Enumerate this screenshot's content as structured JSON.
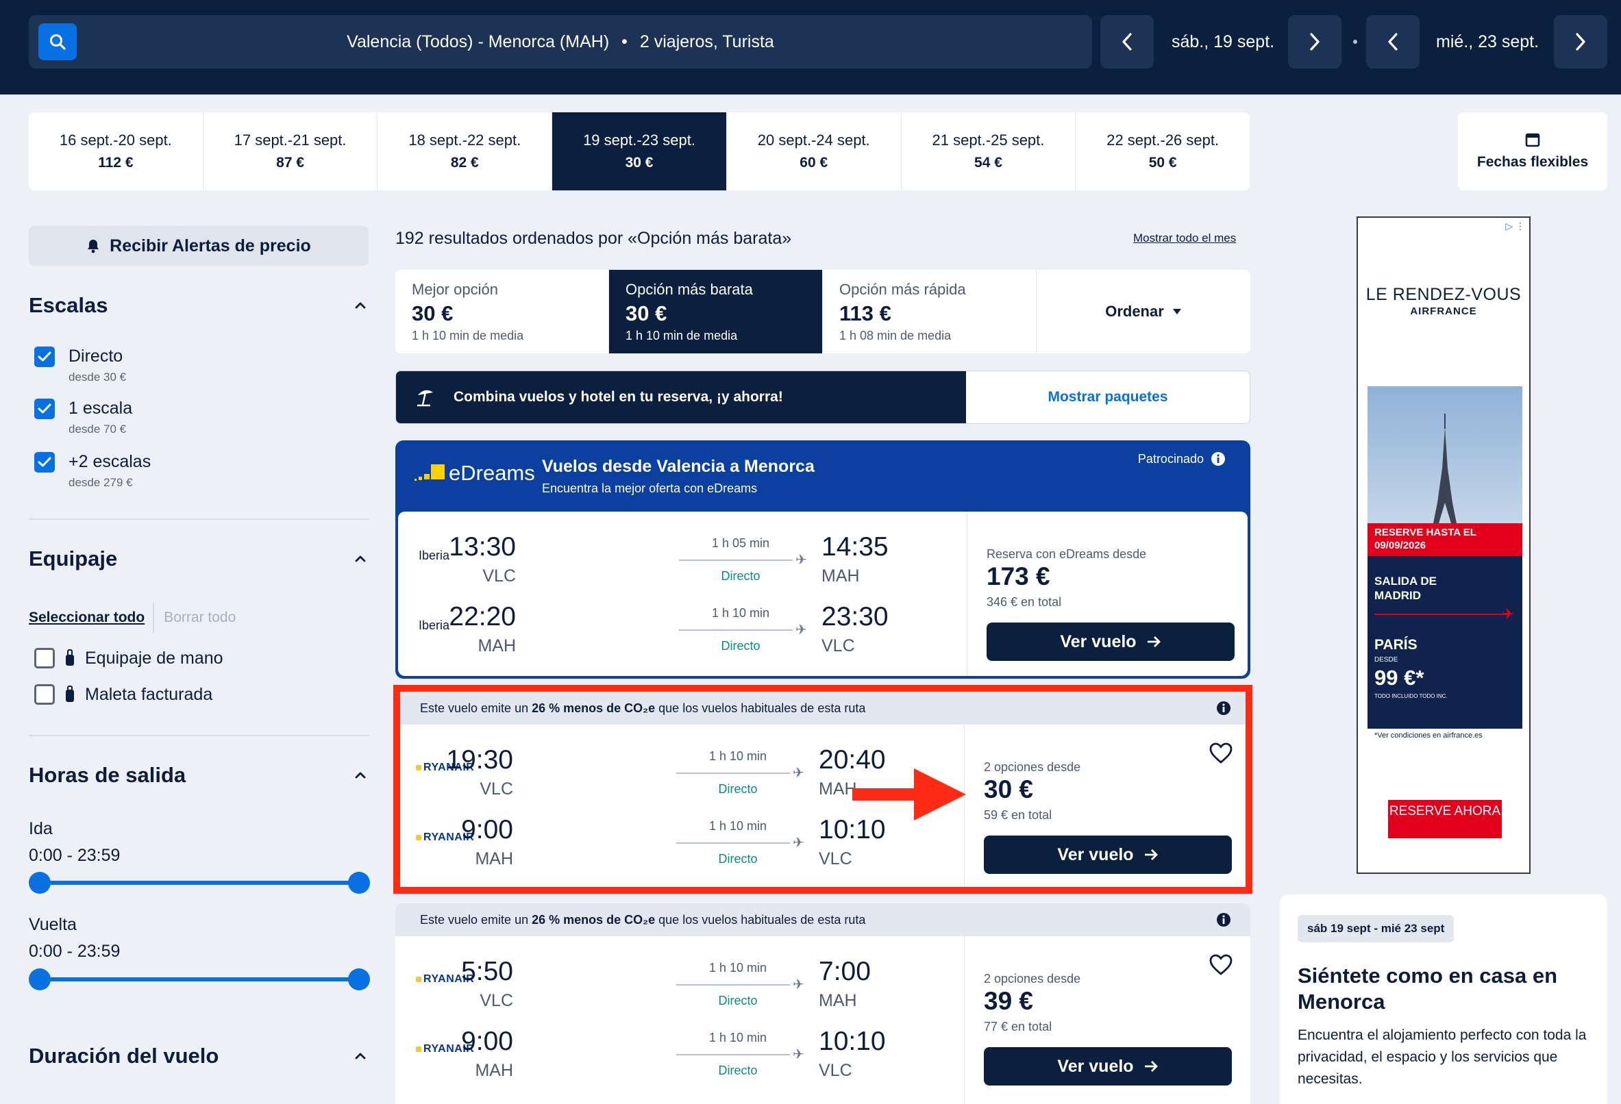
{
  "header": {
    "route": "Valencia (Todos) - Menorca (MAH)",
    "separator": "•",
    "travellers": "2 viajeros, Turista",
    "depart_date": "sáb., 19 sept.",
    "return_date": "mié., 23 sept."
  },
  "date_strip": [
    {
      "dates": "16 sept.-20 sept.",
      "price": "112 €"
    },
    {
      "dates": "17 sept.-21 sept.",
      "price": "87 €"
    },
    {
      "dates": "18 sept.-22 sept.",
      "price": "82 €"
    },
    {
      "dates": "19 sept.-23 sept.",
      "price": "30 €",
      "active": true
    },
    {
      "dates": "20 sept.-24 sept.",
      "price": "60 €"
    },
    {
      "dates": "21 sept.-25 sept.",
      "price": "54 €"
    },
    {
      "dates": "22 sept.-26 sept.",
      "price": "50 €"
    }
  ],
  "flex_dates": "Fechas flexibles",
  "sidebar": {
    "alert_button": "Recibir Alertas de precio",
    "stops_title": "Escalas",
    "stops": [
      {
        "label": "Directo",
        "sub": "desde 30 €",
        "checked": true
      },
      {
        "label": "1 escala",
        "sub": "desde 70 €",
        "checked": true
      },
      {
        "label": "+2 escalas",
        "sub": "desde 279 €",
        "checked": true
      }
    ],
    "baggage_title": "Equipaje",
    "select_all": "Seleccionar todo",
    "clear_all": "Borrar todo",
    "bags": [
      {
        "label": "Equipaje de mano",
        "checked": false
      },
      {
        "label": "Maleta facturada",
        "checked": false
      }
    ],
    "times_title": "Horas de salida",
    "outbound_label": "Ida",
    "outbound_range": "0:00 - 23:59",
    "return_label": "Vuelta",
    "return_range": "0:00 - 23:59",
    "duration_title": "Duración del vuelo"
  },
  "results": {
    "count_text": "192 resultados ordenados por «Opción más barata»",
    "show_month": "Mostrar todo el mes",
    "sort_tabs": [
      {
        "title": "Mejor opción",
        "price": "30 €",
        "sub": "1 h 10 min de media"
      },
      {
        "title": "Opción más barata",
        "price": "30 €",
        "sub": "1 h 10 min de media",
        "active": true
      },
      {
        "title": "Opción más rápida",
        "price": "113 €",
        "sub": "1 h 08 min de media"
      }
    ],
    "order_label": "Ordenar",
    "packages_text": "Combina vuelos y hotel en tu reserva, ¡y ahorra!",
    "packages_link": "Mostrar paquetes"
  },
  "sponsored": {
    "brand": "eDreams",
    "title": "Vuelos desde Valencia a Menorca",
    "subtitle": "Encuentra la mejor oferta con eDreams",
    "tag": "Patrocinado",
    "legs": [
      {
        "airline": "Iberia",
        "dep": "13:30",
        "dep_code": "VLC",
        "duration": "1 h 05 min",
        "stops": "Directo",
        "arr": "14:35",
        "arr_code": "MAH"
      },
      {
        "airline": "Iberia",
        "dep": "22:20",
        "dep_code": "MAH",
        "duration": "1 h 10 min",
        "stops": "Directo",
        "arr": "23:30",
        "arr_code": "VLC"
      }
    ],
    "price_label": "Reserva con eDreams desde",
    "price": "173 €",
    "total": "346 € en total",
    "button": "Ver vuelo"
  },
  "flights": [
    {
      "co2_pre": "Este vuelo emite un ",
      "co2_bold": "26 % menos de CO₂e",
      "co2_post": " que los vuelos habituales de esta ruta",
      "legs": [
        {
          "airline": "RYANAIR",
          "dep": "19:30",
          "dep_code": "VLC",
          "duration": "1 h 10 min",
          "stops": "Directo",
          "arr": "20:40",
          "arr_code": "MAH"
        },
        {
          "airline": "RYANAIR",
          "dep": "9:00",
          "dep_code": "MAH",
          "duration": "1 h 10 min",
          "stops": "Directo",
          "arr": "10:10",
          "arr_code": "VLC"
        }
      ],
      "price_label": "2 opciones desde",
      "price": "30 €",
      "total": "59 € en total",
      "button": "Ver vuelo"
    },
    {
      "co2_pre": "Este vuelo emite un ",
      "co2_bold": "26 % menos de CO₂e",
      "co2_post": " que los vuelos habituales de esta ruta",
      "legs": [
        {
          "airline": "RYANAIR",
          "dep": "5:50",
          "dep_code": "VLC",
          "duration": "1 h 10 min",
          "stops": "Directo",
          "arr": "7:00",
          "arr_code": "MAH"
        },
        {
          "airline": "RYANAIR",
          "dep": "9:00",
          "dep_code": "MAH",
          "duration": "1 h 10 min",
          "stops": "Directo",
          "arr": "10:10",
          "arr_code": "VLC"
        }
      ],
      "price_label": "2 opciones desde",
      "price": "39 €",
      "total": "77 € en total",
      "button": "Ver vuelo"
    }
  ],
  "ad": {
    "brand_line1": "LE RENDEZ-VOUS",
    "brand_line2": "AIRFRANCE",
    "reserve_until": "RESERVE HASTA EL 09/09/2026",
    "departure": "SALIDA DE MADRID",
    "destination": "PARÍS",
    "from_label": "DESDE",
    "price": "99 €*",
    "included": "TODO INCLUIDO TODO INC.",
    "conditions": "*Ver condiciones en airfrance.es",
    "cta": "RESERVE AHORA"
  },
  "lodging": {
    "dates": "sáb 19 sept - mié 23 sept",
    "title": "Siéntete como en casa en Menorca",
    "text": "Encuentra el alojamiento perfecto con toda la privacidad, el espacio y los servicios que necesitas."
  },
  "colors": {
    "navy": "#0b1f3f",
    "accent_blue": "#0770e3",
    "highlight_red": "#ff2a12",
    "stops_green": "#0a8b83"
  }
}
